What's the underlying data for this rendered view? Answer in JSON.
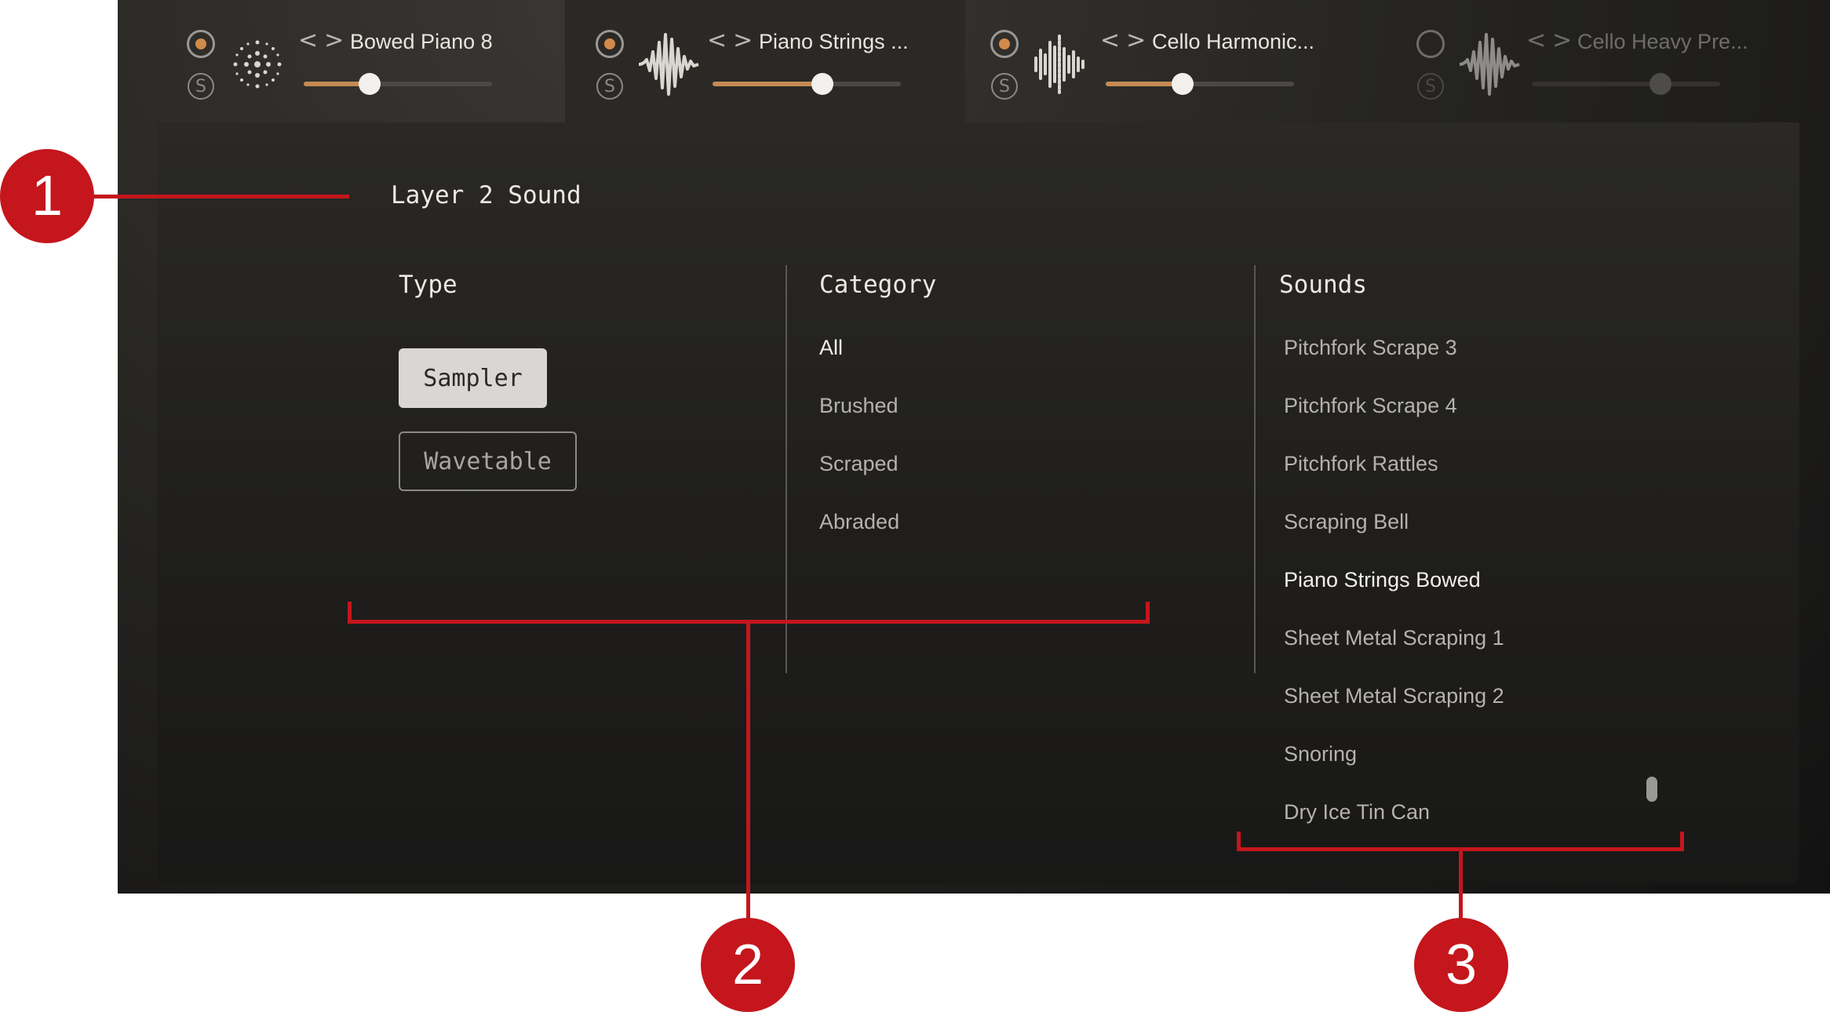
{
  "layers": [
    {
      "name": "Bowed Piano 8",
      "icon": "particles-icon",
      "enabled": true,
      "volume": 0.35,
      "active": false
    },
    {
      "name": "Piano Strings ...",
      "icon": "waveform-icon",
      "enabled": true,
      "volume": 0.58,
      "active": true
    },
    {
      "name": "Cello Harmonic...",
      "icon": "waveform-dense-icon",
      "enabled": true,
      "volume": 0.41,
      "active": false
    },
    {
      "name": "Cello Heavy Pre...",
      "icon": "waveform-icon",
      "enabled": false,
      "volume": 0.68,
      "active": false
    }
  ],
  "solo_label": "S",
  "nav_arrows": "<>",
  "panel": {
    "title": "Layer 2 Sound",
    "type": {
      "heading": "Type",
      "options": [
        "Sampler",
        "Wavetable"
      ],
      "selected": "Sampler"
    },
    "category": {
      "heading": "Category",
      "items": [
        "All",
        "Brushed",
        "Scraped",
        "Abraded"
      ],
      "selected": "All"
    },
    "sounds": {
      "heading": "Sounds",
      "items": [
        "Pitchfork Scrape 3",
        "Pitchfork Scrape 4",
        "Pitchfork Rattles",
        "Scraping Bell",
        "Piano Strings Bowed",
        "Sheet Metal Scraping 1",
        "Sheet Metal Scraping 2",
        "Snoring",
        "Dry Ice Tin Can"
      ],
      "selected": "Piano Strings Bowed"
    }
  },
  "callouts": [
    "1",
    "2",
    "3"
  ],
  "colors": {
    "accent": "#c58a52",
    "annotation": "#c4161c"
  }
}
